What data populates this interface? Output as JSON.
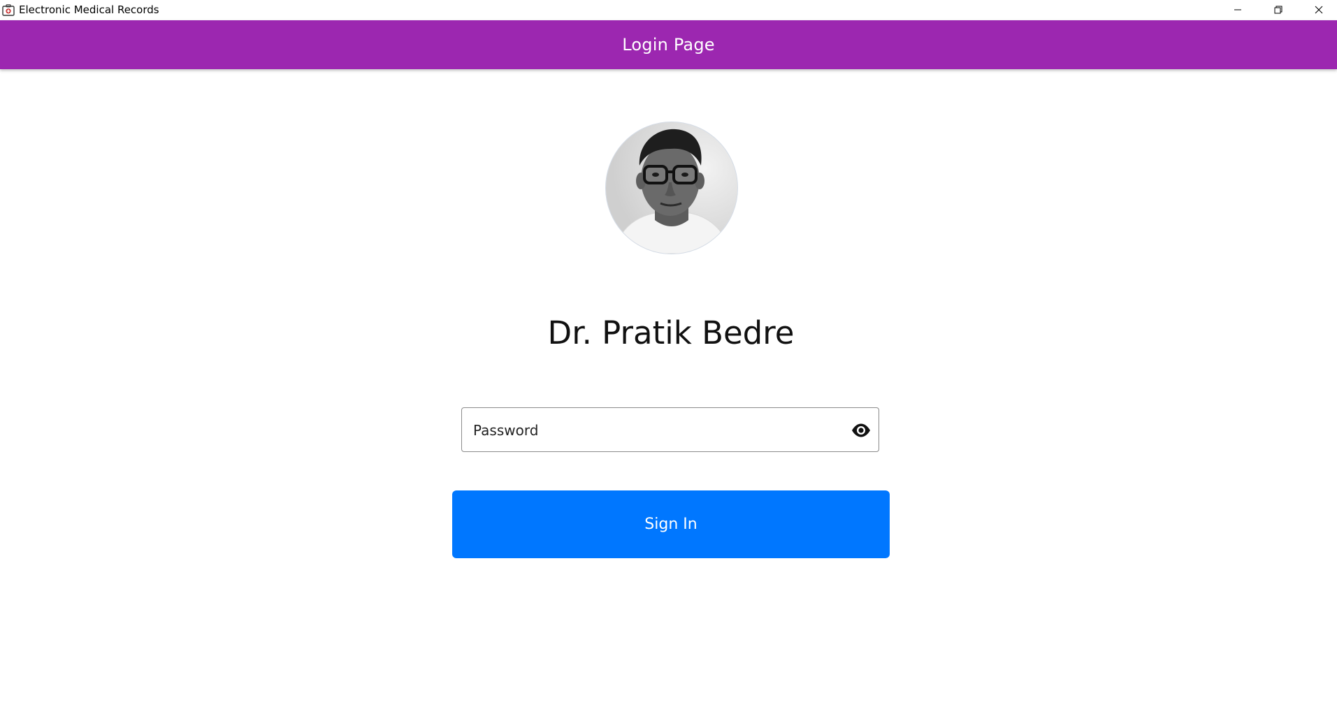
{
  "window": {
    "title": "Electronic Medical Records",
    "icon": "medical-bag-icon",
    "controls": [
      "minimize-icon",
      "restore-icon",
      "close-icon"
    ]
  },
  "appbar": {
    "title": "Login Page",
    "color": "#9c27b0"
  },
  "profile": {
    "avatar": "doctor-photo-avatar",
    "name": "Dr. Pratik Bedre"
  },
  "login": {
    "password_placeholder": "Password",
    "password_value": "",
    "visibility_icon": "eye-icon",
    "signin_label": "Sign In",
    "signin_color": "#0077ff"
  }
}
